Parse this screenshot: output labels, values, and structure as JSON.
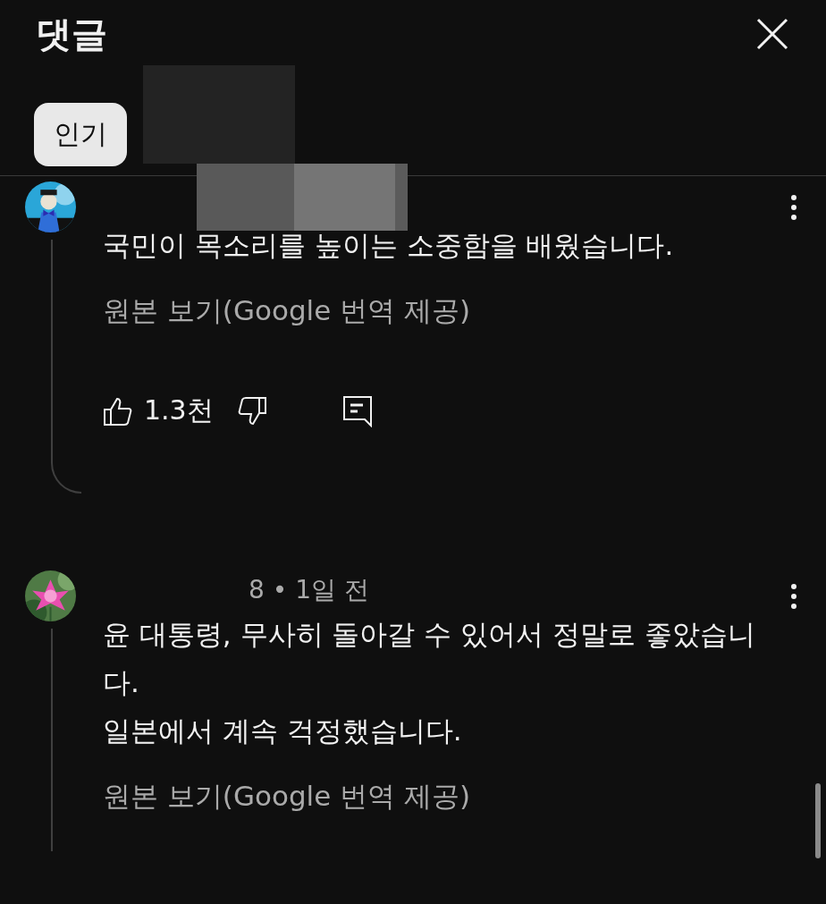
{
  "header": {
    "title": "댓글"
  },
  "sort_chips": [
    {
      "label": "인기",
      "selected": true
    }
  ],
  "comments": [
    {
      "text": [
        "국민이 목소리를 높이는 소중함을 배웠습니다."
      ],
      "translation_link": "원본 보기(Google 번역 제공)",
      "likes": "1.3천"
    },
    {
      "meta": "8 • 1일 전",
      "text": [
        "윤 대통령, 무사히 돌아갈 수 있어서 정말로 좋았습니다.",
        "일본에서 계속 걱정했습니다."
      ],
      "translation_link": "원본 보기(Google 번역 제공)"
    }
  ]
}
